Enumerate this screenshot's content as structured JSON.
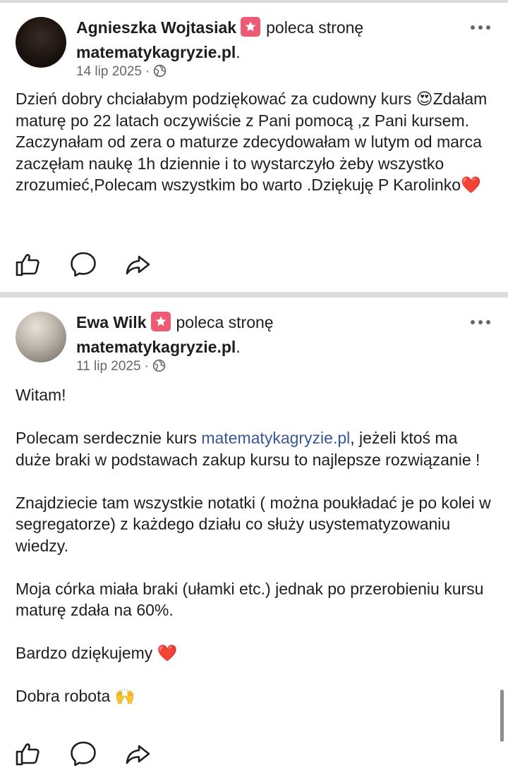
{
  "posts": [
    {
      "author": "Agnieszka Wojtasiak",
      "action": "poleca stronę",
      "page": "matematykagryzie.pl",
      "date": "14 lip 2025",
      "separator": "·",
      "paragraphs": [
        "Dzień dobry  chciałabym  podziękować za cudowny kurs 😍Zdałam  maturę  po 22 latach oczywiście  z Pani pomocą ,z Pani kursem. Zaczynałam od zera o maturze zdecydowałam w lutym od marca zaczęłam naukę  1h dziennie i to wystarczyło  żeby wszystko zrozumieć,Polecam wszystkim  bo warto .Dziękuję P Karolinko❤️"
      ]
    },
    {
      "author": "Ewa Wilk",
      "action": "poleca stronę",
      "page": "matematykagryzie.pl",
      "date": "11 lip 2025",
      "separator": "·",
      "greeting": "Witam!",
      "recommend_prefix": "Polecam serdecznie kurs ",
      "recommend_link": "matematykagryzie.pl",
      "recommend_suffix": ", jeżeli ktoś ma duże braki w podstawach zakup kursu to najlepsze rozwiązanie !",
      "paragraphs": [
        "Znajdziecie tam wszystkie notatki ( można poukładać je po kolei w segregatorze) z każdego działu co służy usystematyzowaniu wiedzy.",
        "Moja córka miała braki (ułamki etc.) jednak po przerobieniu kursu maturę zdała na 60%.",
        "Bardzo dziękujemy ❤️",
        "Dobra robota 🙌"
      ]
    }
  ],
  "icons": {
    "badge": "recommend-star-icon",
    "privacy": "globe-icon",
    "more": "more-options-icon",
    "like": "thumbs-up-icon",
    "comment": "comment-bubble-icon",
    "share": "share-arrow-icon"
  },
  "colors": {
    "badge": "#ec5b73",
    "link": "#385898",
    "meta": "#65676b",
    "divider": "#d9dbde"
  }
}
